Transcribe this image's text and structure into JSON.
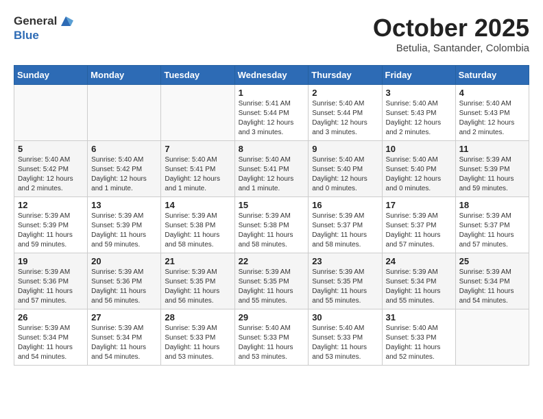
{
  "header": {
    "logo_general": "General",
    "logo_blue": "Blue",
    "month_year": "October 2025",
    "location": "Betulia, Santander, Colombia"
  },
  "days_of_week": [
    "Sunday",
    "Monday",
    "Tuesday",
    "Wednesday",
    "Thursday",
    "Friday",
    "Saturday"
  ],
  "weeks": [
    [
      {
        "day": "",
        "content": ""
      },
      {
        "day": "",
        "content": ""
      },
      {
        "day": "",
        "content": ""
      },
      {
        "day": "1",
        "content": "Sunrise: 5:41 AM\nSunset: 5:44 PM\nDaylight: 12 hours and 3 minutes."
      },
      {
        "day": "2",
        "content": "Sunrise: 5:40 AM\nSunset: 5:44 PM\nDaylight: 12 hours and 3 minutes."
      },
      {
        "day": "3",
        "content": "Sunrise: 5:40 AM\nSunset: 5:43 PM\nDaylight: 12 hours and 2 minutes."
      },
      {
        "day": "4",
        "content": "Sunrise: 5:40 AM\nSunset: 5:43 PM\nDaylight: 12 hours and 2 minutes."
      }
    ],
    [
      {
        "day": "5",
        "content": "Sunrise: 5:40 AM\nSunset: 5:42 PM\nDaylight: 12 hours and 2 minutes."
      },
      {
        "day": "6",
        "content": "Sunrise: 5:40 AM\nSunset: 5:42 PM\nDaylight: 12 hours and 1 minute."
      },
      {
        "day": "7",
        "content": "Sunrise: 5:40 AM\nSunset: 5:41 PM\nDaylight: 12 hours and 1 minute."
      },
      {
        "day": "8",
        "content": "Sunrise: 5:40 AM\nSunset: 5:41 PM\nDaylight: 12 hours and 1 minute."
      },
      {
        "day": "9",
        "content": "Sunrise: 5:40 AM\nSunset: 5:40 PM\nDaylight: 12 hours and 0 minutes."
      },
      {
        "day": "10",
        "content": "Sunrise: 5:40 AM\nSunset: 5:40 PM\nDaylight: 12 hours and 0 minutes."
      },
      {
        "day": "11",
        "content": "Sunrise: 5:39 AM\nSunset: 5:39 PM\nDaylight: 11 hours and 59 minutes."
      }
    ],
    [
      {
        "day": "12",
        "content": "Sunrise: 5:39 AM\nSunset: 5:39 PM\nDaylight: 11 hours and 59 minutes."
      },
      {
        "day": "13",
        "content": "Sunrise: 5:39 AM\nSunset: 5:39 PM\nDaylight: 11 hours and 59 minutes."
      },
      {
        "day": "14",
        "content": "Sunrise: 5:39 AM\nSunset: 5:38 PM\nDaylight: 11 hours and 58 minutes."
      },
      {
        "day": "15",
        "content": "Sunrise: 5:39 AM\nSunset: 5:38 PM\nDaylight: 11 hours and 58 minutes."
      },
      {
        "day": "16",
        "content": "Sunrise: 5:39 AM\nSunset: 5:37 PM\nDaylight: 11 hours and 58 minutes."
      },
      {
        "day": "17",
        "content": "Sunrise: 5:39 AM\nSunset: 5:37 PM\nDaylight: 11 hours and 57 minutes."
      },
      {
        "day": "18",
        "content": "Sunrise: 5:39 AM\nSunset: 5:37 PM\nDaylight: 11 hours and 57 minutes."
      }
    ],
    [
      {
        "day": "19",
        "content": "Sunrise: 5:39 AM\nSunset: 5:36 PM\nDaylight: 11 hours and 57 minutes."
      },
      {
        "day": "20",
        "content": "Sunrise: 5:39 AM\nSunset: 5:36 PM\nDaylight: 11 hours and 56 minutes."
      },
      {
        "day": "21",
        "content": "Sunrise: 5:39 AM\nSunset: 5:35 PM\nDaylight: 11 hours and 56 minutes."
      },
      {
        "day": "22",
        "content": "Sunrise: 5:39 AM\nSunset: 5:35 PM\nDaylight: 11 hours and 55 minutes."
      },
      {
        "day": "23",
        "content": "Sunrise: 5:39 AM\nSunset: 5:35 PM\nDaylight: 11 hours and 55 minutes."
      },
      {
        "day": "24",
        "content": "Sunrise: 5:39 AM\nSunset: 5:34 PM\nDaylight: 11 hours and 55 minutes."
      },
      {
        "day": "25",
        "content": "Sunrise: 5:39 AM\nSunset: 5:34 PM\nDaylight: 11 hours and 54 minutes."
      }
    ],
    [
      {
        "day": "26",
        "content": "Sunrise: 5:39 AM\nSunset: 5:34 PM\nDaylight: 11 hours and 54 minutes."
      },
      {
        "day": "27",
        "content": "Sunrise: 5:39 AM\nSunset: 5:34 PM\nDaylight: 11 hours and 54 minutes."
      },
      {
        "day": "28",
        "content": "Sunrise: 5:39 AM\nSunset: 5:33 PM\nDaylight: 11 hours and 53 minutes."
      },
      {
        "day": "29",
        "content": "Sunrise: 5:40 AM\nSunset: 5:33 PM\nDaylight: 11 hours and 53 minutes."
      },
      {
        "day": "30",
        "content": "Sunrise: 5:40 AM\nSunset: 5:33 PM\nDaylight: 11 hours and 53 minutes."
      },
      {
        "day": "31",
        "content": "Sunrise: 5:40 AM\nSunset: 5:33 PM\nDaylight: 11 hours and 52 minutes."
      },
      {
        "day": "",
        "content": ""
      }
    ]
  ]
}
